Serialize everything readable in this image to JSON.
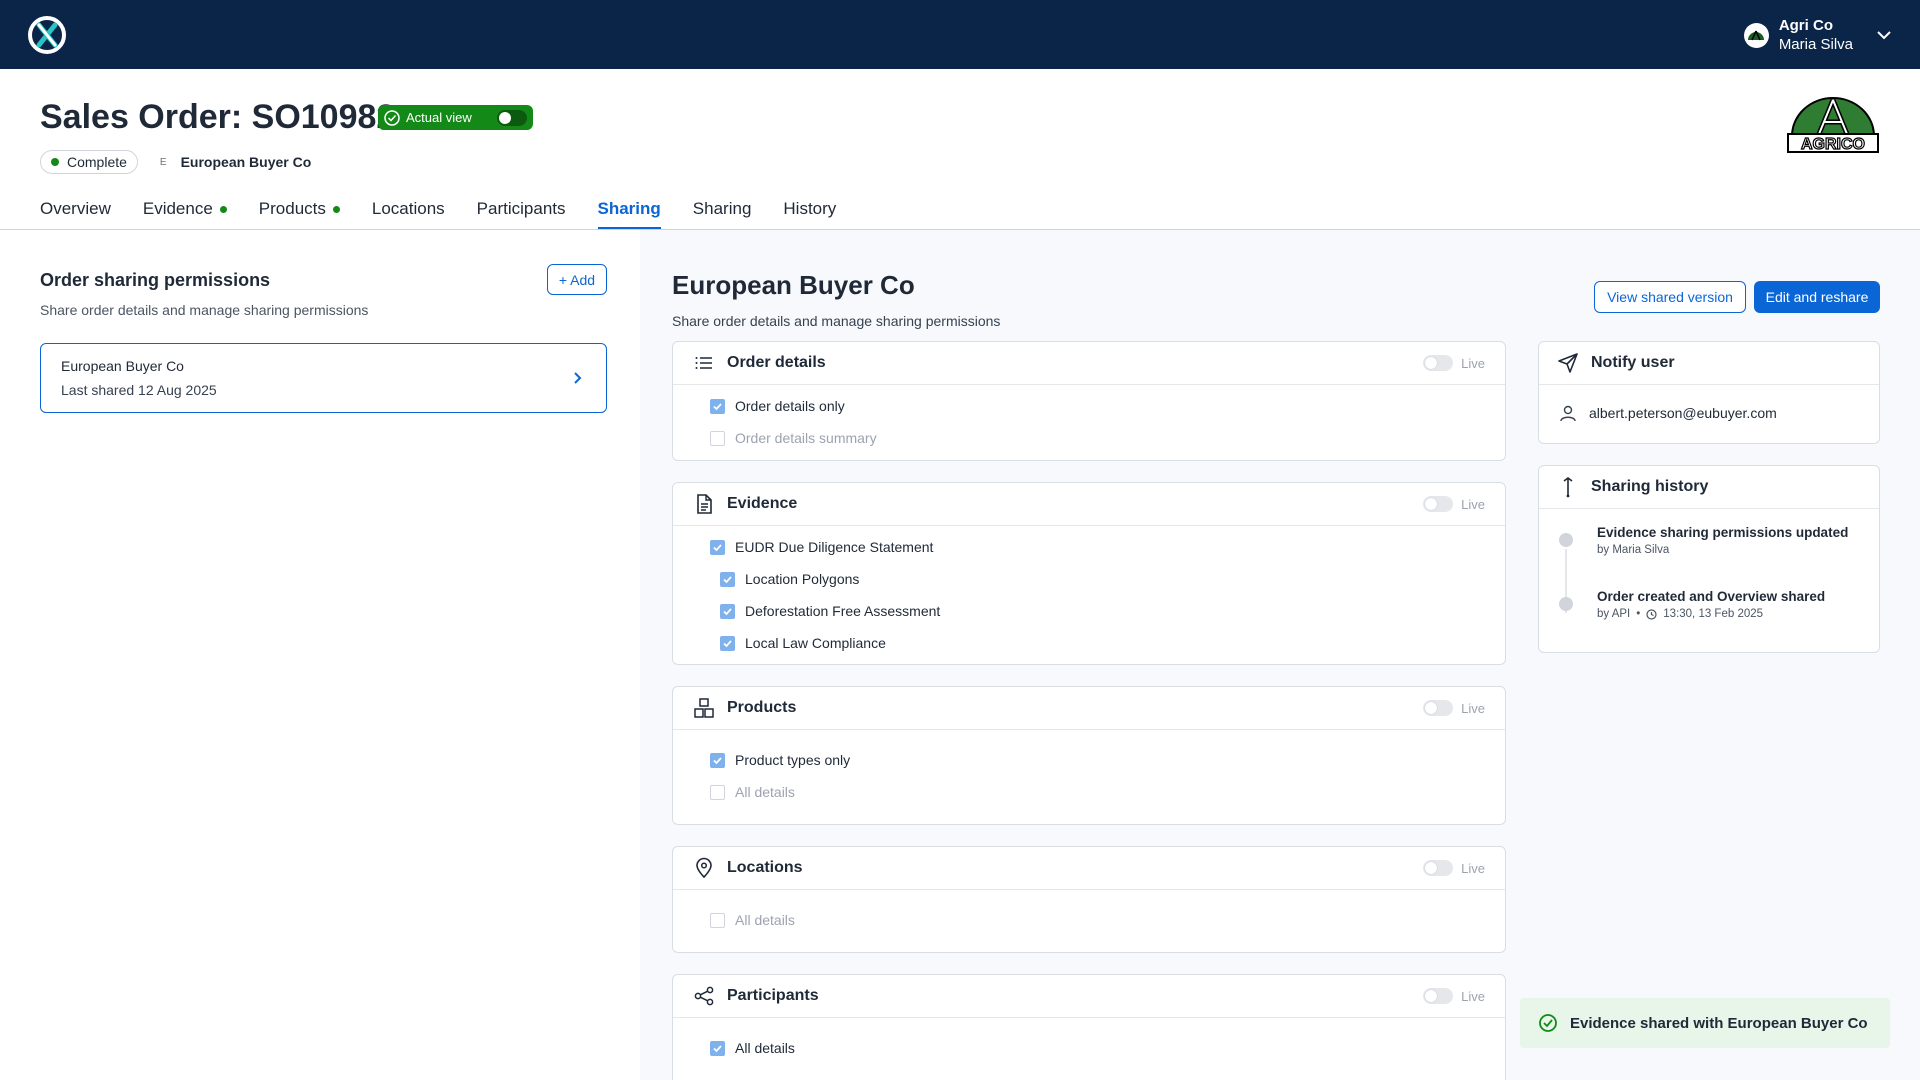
{
  "header": {
    "title": "Sales Order: SO10982",
    "actual_view_label": "Actual view",
    "status": "Complete",
    "buyer_initial": "E",
    "buyer_name": "European Buyer Co",
    "brand_logo_text": "AGRICO"
  },
  "user": {
    "org": "Agri Co",
    "name": "Maria Silva"
  },
  "tabs": [
    {
      "label": "Overview",
      "dot": false
    },
    {
      "label": "Evidence",
      "dot": true
    },
    {
      "label": "Products",
      "dot": true
    },
    {
      "label": "Locations",
      "dot": false
    },
    {
      "label": "Participants",
      "dot": false
    },
    {
      "label": "Sharing",
      "dot": false,
      "active": true
    },
    {
      "label": "Sharing",
      "dot": false
    },
    {
      "label": "History",
      "dot": false
    }
  ],
  "left_panel": {
    "title": "Order sharing permissions",
    "subtitle": "Share order details and manage sharing permissions",
    "add_label": "+ Add",
    "card": {
      "name": "European Buyer Co",
      "last_shared": "Last shared 12 Aug 2025"
    }
  },
  "main": {
    "title": "European Buyer Co",
    "subtitle": "Share order details and manage sharing permissions",
    "view_shared_label": "View shared version",
    "edit_reshare_label": "Edit and reshare",
    "live_label": "Live",
    "sections": {
      "order_details": {
        "title": "Order details",
        "options": [
          {
            "label": "Order details only",
            "checked": true
          },
          {
            "label": "Order details summary",
            "checked": false
          }
        ]
      },
      "evidence": {
        "title": "Evidence",
        "options": [
          {
            "label": "EUDR Due Diligence Statement",
            "checked": true
          },
          {
            "label": "Location Polygons",
            "checked": true
          },
          {
            "label": "Deforestation Free Assessment",
            "checked": true
          },
          {
            "label": "Local Law Compliance",
            "checked": true
          }
        ]
      },
      "products": {
        "title": "Products",
        "options": [
          {
            "label": "Product types only",
            "checked": true
          },
          {
            "label": "All details",
            "checked": false
          }
        ]
      },
      "locations": {
        "title": "Locations",
        "options": [
          {
            "label": "All details",
            "checked": false
          }
        ]
      },
      "participants": {
        "title": "Participants",
        "options": [
          {
            "label": "All details",
            "checked": true
          }
        ]
      }
    }
  },
  "notify": {
    "title": "Notify user",
    "email": "albert.peterson@eubuyer.com"
  },
  "history": {
    "title": "Sharing history",
    "items": [
      {
        "title": "Evidence sharing permissions updated",
        "by": "by Maria Silva"
      },
      {
        "title": "Order created and Overview shared",
        "by": "by API",
        "time": "13:30, 13 Feb 2025"
      }
    ]
  },
  "toast": {
    "message": "Evidence shared with European Buyer Co"
  },
  "colors": {
    "topbar": "#0b2549",
    "accent": "#0a66d6",
    "success": "#138a17"
  }
}
